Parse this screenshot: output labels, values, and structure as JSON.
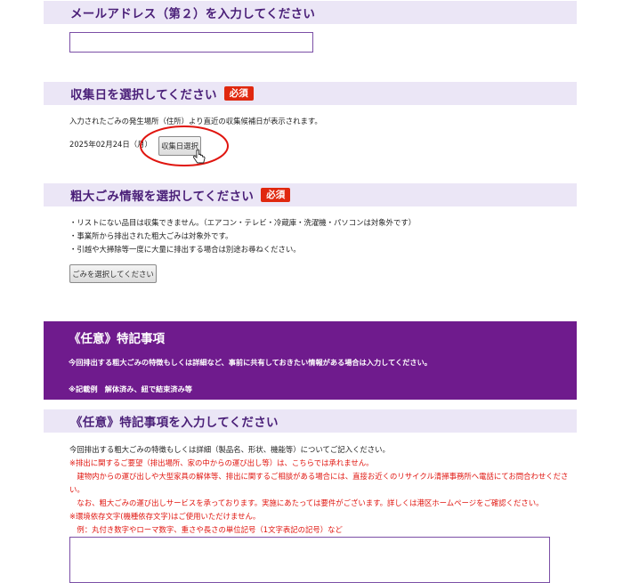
{
  "email2": {
    "heading": "メールアドレス（第２）を入力してください",
    "value": ""
  },
  "collection": {
    "heading": "収集日を選択してください",
    "required": "必須",
    "note": "入力されたごみの発生場所（住所）より直近の収集候補日が表示されます。",
    "selected_date": "2025年02月24日（月）",
    "button": "収集日選択"
  },
  "items": {
    "heading": "粗大ごみ情報を選択してください",
    "required": "必須",
    "notes": [
      "・リストにない品目は収集できません。（エアコン・テレビ・冷蔵庫・洗濯機・パソコンは対象外です）",
      "・事業所から排出された粗大ごみは対象外です。",
      "・引越や大掃除等一度に大量に排出する場合は別途お尋ねください。"
    ],
    "button": "ごみを選択してください"
  },
  "optional_banner": {
    "title": "《任意》特記事項",
    "line1": "今回排出する粗大ごみの特徴もしくは詳細など、事前に共有しておきたい情報がある場合は入力してください。",
    "line2": "※記載例　解体済み、紐で結束済み等"
  },
  "optional_input": {
    "heading": "《任意》特記事項を入力してください",
    "lines": [
      {
        "text": "今回排出する粗大ごみの特徴もしくは詳細（製品名、形状、機能等）についてご記入ください。",
        "color": "#222222"
      },
      {
        "text": "※排出に関するご要望（排出場所、家の中からの運び出し等）は、こちらでは承れません。",
        "color": "#e0150f"
      },
      {
        "text": "　建物内からの運び出しや大型家具の解体等、排出に関するご相談がある場合には、直接お近くのリサイクル清掃事務所へ電話にてお問合わせくださ",
        "color": "#e0150f"
      },
      {
        "text": "い。",
        "color": "#e0150f"
      },
      {
        "text": "　なお、粗大ごみの運び出しサービスを承っております。実施にあたっては要件がございます。詳しくは港区ホームページをご確認ください。",
        "color": "#e0150f"
      },
      {
        "text": "※環境依存文字(機種依存文字)はご使用いただけません。",
        "color": "#e0150f"
      },
      {
        "text": "　例：丸付き数字やローマ数字、重さや長さの単位記号（1文字表記の記号）など",
        "color": "#e0150f"
      }
    ],
    "value": ""
  },
  "colors": {
    "accent": "#6f1b8d",
    "header_bg": "#ebe6f6",
    "required": "#e0280f",
    "highlight": "#e0150f"
  }
}
